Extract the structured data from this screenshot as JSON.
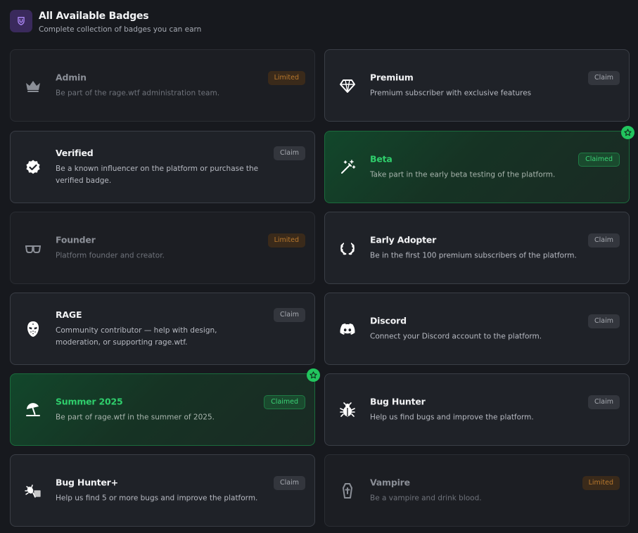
{
  "header": {
    "title": "All Available Badges",
    "subtitle": "Complete collection of badges you can earn",
    "icon": "shield-icon"
  },
  "colors": {
    "claimed_accent": "#22c55e",
    "limited_accent": "#b8782d",
    "header_icon_bg": "#3a2a5c"
  },
  "badges": [
    {
      "title": "Admin",
      "desc": "Be part of the rage.wtf administration team.",
      "status": "Limited",
      "icon": "crown-icon"
    },
    {
      "title": "Premium",
      "desc": "Premium subscriber with exclusive features",
      "status": "Claim",
      "icon": "diamond-icon"
    },
    {
      "title": "Verified",
      "desc": "Be a known influencer on the platform or purchase the verified badge.",
      "status": "Claim",
      "icon": "verified-check-icon"
    },
    {
      "title": "Beta",
      "desc": "Take part in the early beta testing of the platform.",
      "status": "Claimed",
      "icon": "magic-wand-icon"
    },
    {
      "title": "Founder",
      "desc": "Platform founder and creator.",
      "status": "Limited",
      "icon": "glasses-icon"
    },
    {
      "title": "Early Adopter",
      "desc": "Be in the first 100 premium subscribers of the platform.",
      "status": "Claim",
      "icon": "laurel-icon"
    },
    {
      "title": "RAGE",
      "desc": "Community contributor — help with design, moderation, or supporting rage.wtf.",
      "status": "Claim",
      "icon": "hockey-mask-icon"
    },
    {
      "title": "Discord",
      "desc": "Connect your Discord account to the platform.",
      "status": "Claim",
      "icon": "discord-icon"
    },
    {
      "title": "Summer 2025",
      "desc": "Be part of rage.wtf in the summer of 2025.",
      "status": "Claimed",
      "icon": "beach-umbrella-icon"
    },
    {
      "title": "Bug Hunter",
      "desc": "Help us find bugs and improve the platform.",
      "status": "Claim",
      "icon": "bug-icon"
    },
    {
      "title": "Bug Hunter+",
      "desc": "Help us find 5 or more bugs and improve the platform.",
      "status": "Claim",
      "icon": "bug-net-icon"
    },
    {
      "title": "Vampire",
      "desc": "Be a vampire and drink blood.",
      "status": "Limited",
      "icon": "coffin-icon"
    }
  ]
}
